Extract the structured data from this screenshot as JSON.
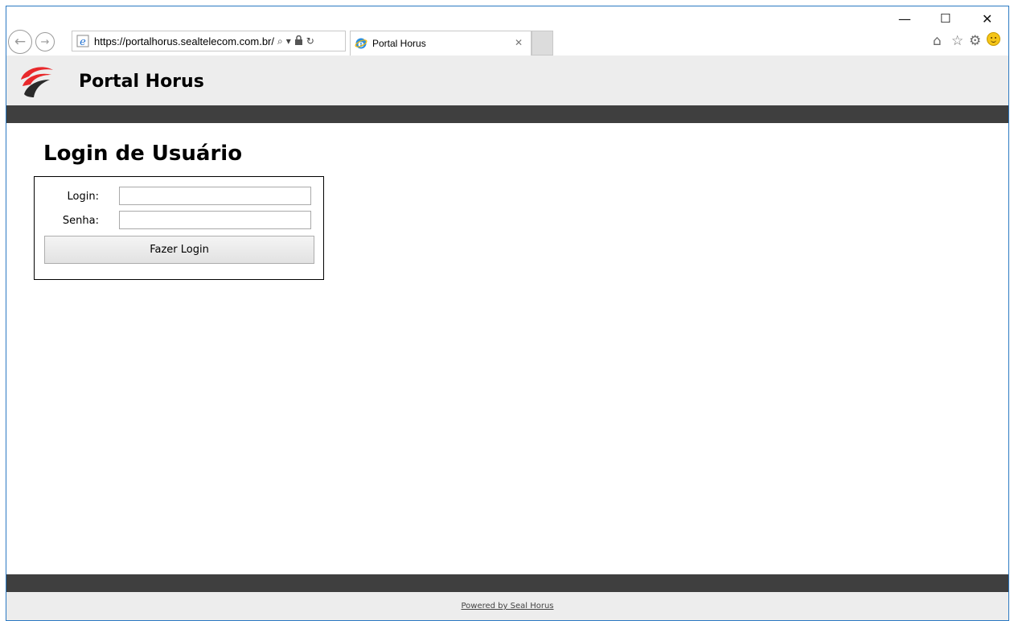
{
  "browser": {
    "url": "https://portalhorus.sealtelecom.com.br/",
    "tab_title": "Portal Horus",
    "search_icon": "⌕",
    "dropdown_icon": "▾",
    "lock_icon": "🔒",
    "refresh_icon": "↻",
    "close_tab_icon": "✕",
    "back_icon": "←",
    "forward_icon": "→",
    "minimize_icon": "—",
    "maximize_icon": "☐",
    "close_icon": "✕",
    "home_icon": "⌂",
    "favorites_icon": "☆",
    "settings_icon": "⚙"
  },
  "header": {
    "title": "Portal Horus"
  },
  "login": {
    "heading": "Login de Usuário",
    "login_label": "Login:",
    "login_value": "",
    "senha_label": "Senha:",
    "senha_value": "",
    "submit_label": "Fazer Login"
  },
  "footer": {
    "text": "Powered by Seal Horus"
  },
  "colors": {
    "header_bg": "#ededed",
    "bar_dark": "#3f3f3f",
    "logo_red": "#e8282b",
    "logo_dark": "#2a2a2a"
  }
}
